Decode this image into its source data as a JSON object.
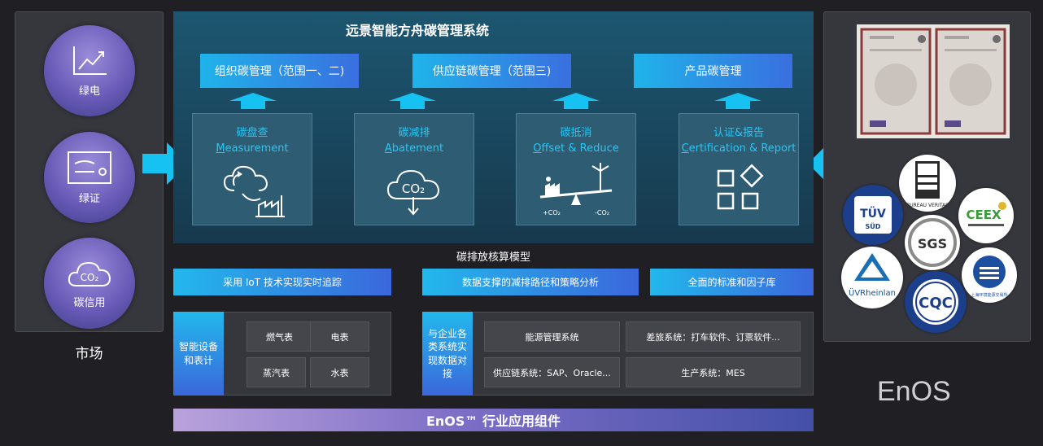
{
  "market": {
    "items": [
      {
        "label": "绿电",
        "icon": "trend-chart-icon"
      },
      {
        "label": "绿证",
        "icon": "certificate-icon"
      },
      {
        "label": "碳信用",
        "icon": "co2-cloud-icon",
        "icon_text": "CO₂"
      }
    ],
    "title": "市场"
  },
  "system": {
    "title": "远景智能方舟碳管理系统",
    "categories": [
      {
        "label": "组织碳管理（范围一、二)"
      },
      {
        "label": "供应链碳管理（范围三)"
      },
      {
        "label": "产品碳管理"
      }
    ],
    "modules": [
      {
        "cn": "碳盘查",
        "en_initial": "M",
        "en_rest": "easurement",
        "icon": "measurement-icon"
      },
      {
        "cn": "碳减排",
        "en_initial": "A",
        "en_rest": "batement",
        "icon": "co2-cloud-down-icon",
        "icon_text": "CO₂"
      },
      {
        "cn": "碳抵消",
        "en_initial": "O",
        "en_rest": "ffset & Reduce",
        "icon": "offset-balance-icon",
        "plus_label": "+CO₂",
        "minus_label": "-CO₂"
      },
      {
        "cn": "认证&报告",
        "en_initial": "C",
        "en_rest": "ertification & Report",
        "icon": "grid-shapes-icon"
      }
    ]
  },
  "model_label": "碳排放核算模型",
  "features": [
    "采用 IoT 技术实现实时追踪",
    "数据支撑的减排路径和策略分析",
    "全面的标准和因子库"
  ],
  "devices": {
    "title": "智能设备和表计",
    "items": [
      "燃气表",
      "电表",
      "蒸汽表",
      "水表"
    ]
  },
  "integration": {
    "title": "与企业各类系统实现数据对接",
    "items": [
      "能源管理系统",
      "差旅系统：打车软件、订票软件...",
      "供应链系统：SAP、Oracle...",
      "生产系统：MES"
    ]
  },
  "enos_bar": "EnOS™ 行业应用组件",
  "certs": {
    "badges": [
      {
        "name": "bureau-veritas-badge",
        "text": "BUREAU VERITAS"
      },
      {
        "name": "tuv-sud-badge",
        "text": "TÜV SÜD"
      },
      {
        "name": "ceex-badge",
        "text": "CEEX"
      },
      {
        "name": "sgs-badge",
        "text": "SGS"
      },
      {
        "name": "tuv-rheinland-badge",
        "text": "ÜVRheinlan"
      },
      {
        "name": "cqc-badge",
        "text": "CQC"
      },
      {
        "name": "shanghai-exchange-badge",
        "text": "上海环境能源交易所"
      }
    ]
  },
  "brand": "EnOS",
  "colors": {
    "accent": "#27c6f5",
    "bar_start": "#22b8ec",
    "bar_end": "#3b67db"
  }
}
